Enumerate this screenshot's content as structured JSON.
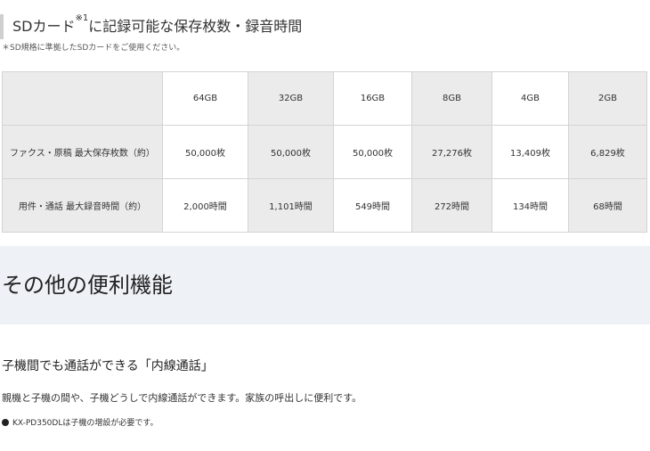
{
  "storage_section": {
    "heading": "SDカード",
    "heading_sup": "※1",
    "heading_rest": "に記録可能な保存枚数・録音時間",
    "note": "＊SD規格に準拠したSDカードをご使用ください。"
  },
  "capacity_table": {
    "columns": [
      "64GB",
      "32GB",
      "16GB",
      "8GB",
      "4GB",
      "2GB"
    ],
    "rows": [
      {
        "label": "ファクス・原稿 最大保存枚数（約）",
        "values": [
          "50,000枚",
          "50,000枚",
          "50,000枚",
          "27,276枚",
          "13,409枚",
          "6,829枚"
        ]
      },
      {
        "label": "用件・通話 最大録音時間（約）",
        "values": [
          "2,000時間",
          "1,101時間",
          "549時間",
          "272時間",
          "134時間",
          "68時間"
        ]
      }
    ]
  },
  "feature": {
    "title": "その他の便利機能",
    "subtitle": "子機間でも通話ができる「内線通話」",
    "description": "親機と子機の間や、子機どうしで内線通話ができます。家族の呼出しに便利です。",
    "bullet": "KX-PD350DLは子機の増設が必要です。"
  }
}
